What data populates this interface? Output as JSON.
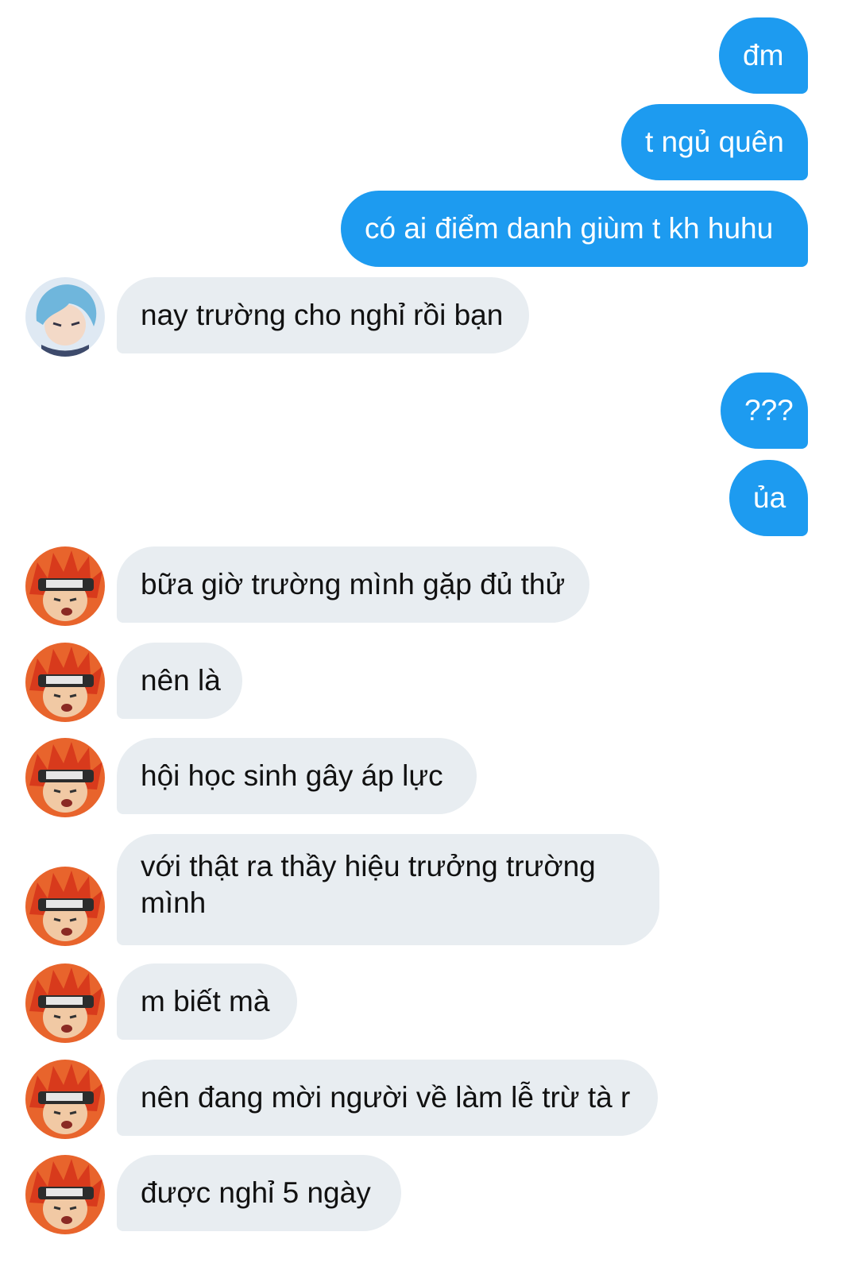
{
  "messages": [
    {
      "side": "out",
      "text": "đm"
    },
    {
      "side": "out",
      "text": "t ngủ quên"
    },
    {
      "side": "out",
      "text": "có ai điểm danh giùm t kh huhu"
    },
    {
      "side": "in",
      "avatar": "blue-hair-avatar",
      "text": "nay trường cho nghỉ rồi bạn"
    },
    {
      "side": "out",
      "text": "???"
    },
    {
      "side": "out",
      "text": "ủa"
    },
    {
      "side": "in",
      "avatar": "red-hair-avatar",
      "text": "bữa giờ trường mình gặp đủ thử"
    },
    {
      "side": "in",
      "avatar": "red-hair-avatar",
      "text": "nên là"
    },
    {
      "side": "in",
      "avatar": "red-hair-avatar",
      "text": "hội học sinh gây áp lực"
    },
    {
      "side": "in",
      "avatar": "red-hair-avatar",
      "text": "với thật ra thầy hiệu trưởng trường mình"
    },
    {
      "side": "in",
      "avatar": "red-hair-avatar",
      "text": "m biết mà"
    },
    {
      "side": "in",
      "avatar": "red-hair-avatar",
      "text": "nên đang mời người về làm lễ trừ tà r"
    },
    {
      "side": "in",
      "avatar": "red-hair-avatar",
      "text": "được nghỉ 5 ngày"
    }
  ],
  "colors": {
    "outgoing": "#1d9bf0",
    "incoming": "#e8edf1"
  }
}
